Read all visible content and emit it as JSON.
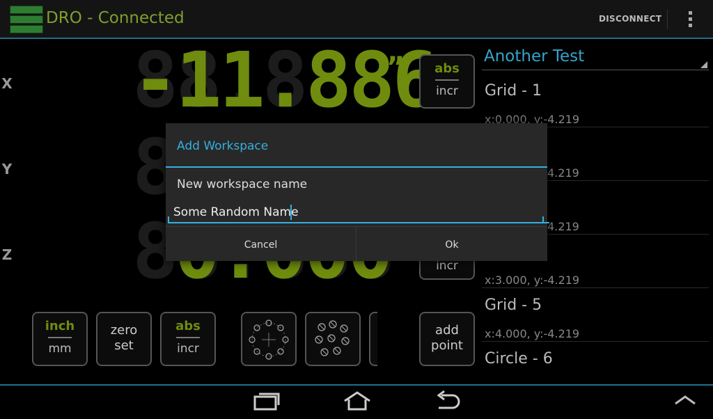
{
  "actionbar": {
    "title": "DRO - Connected",
    "disconnect_label": "DISCONNECT",
    "icon": "app-drawer-icon",
    "overflow_icon": "overflow-menu-icon"
  },
  "axes": {
    "x": {
      "label": "X",
      "value": "-11.886",
      "unit": "”"
    },
    "y": {
      "label": "Y"
    },
    "z": {
      "label": "Z",
      "value": "0.000"
    }
  },
  "buttons": {
    "abs_incr_top": "abs",
    "abs_incr_bottom": "incr",
    "z_incr": "incr",
    "inch": "inch",
    "mm": "mm",
    "zero": "zero",
    "set": "set",
    "abs": "abs",
    "incr": "incr",
    "bolt_circle_icon": "bolt-circle-icon",
    "bolt_grid_icon": "bolt-pattern-icon",
    "add": "add",
    "point": "point"
  },
  "workspace": {
    "title": "Another Test",
    "items": [
      {
        "title": "Grid - 1",
        "coords": "x:0.000, y:-4.219"
      },
      {
        "title": "",
        "coords": "4.219"
      },
      {
        "title": "",
        "coords": "4.219"
      },
      {
        "title": "",
        "coords": "x:3.000, y:-4.219"
      },
      {
        "title": "Grid - 5",
        "coords": "x:4.000, y:-4.219"
      },
      {
        "title": "Circle - 6",
        "coords": ""
      }
    ]
  },
  "dialog": {
    "title": "Add Workspace",
    "message": "New workspace name",
    "input_value": "Some Random Name",
    "cancel_label": "Cancel",
    "ok_label": "Ok"
  },
  "nav": {
    "recents_icon": "recent-apps-icon",
    "home_icon": "home-icon",
    "back_icon": "back-icon",
    "up_icon": "chevron-up-icon"
  },
  "colors": {
    "accent": "#35b0e0",
    "digit_green": "#6f8c0e",
    "title_green": "#7fa02e"
  }
}
